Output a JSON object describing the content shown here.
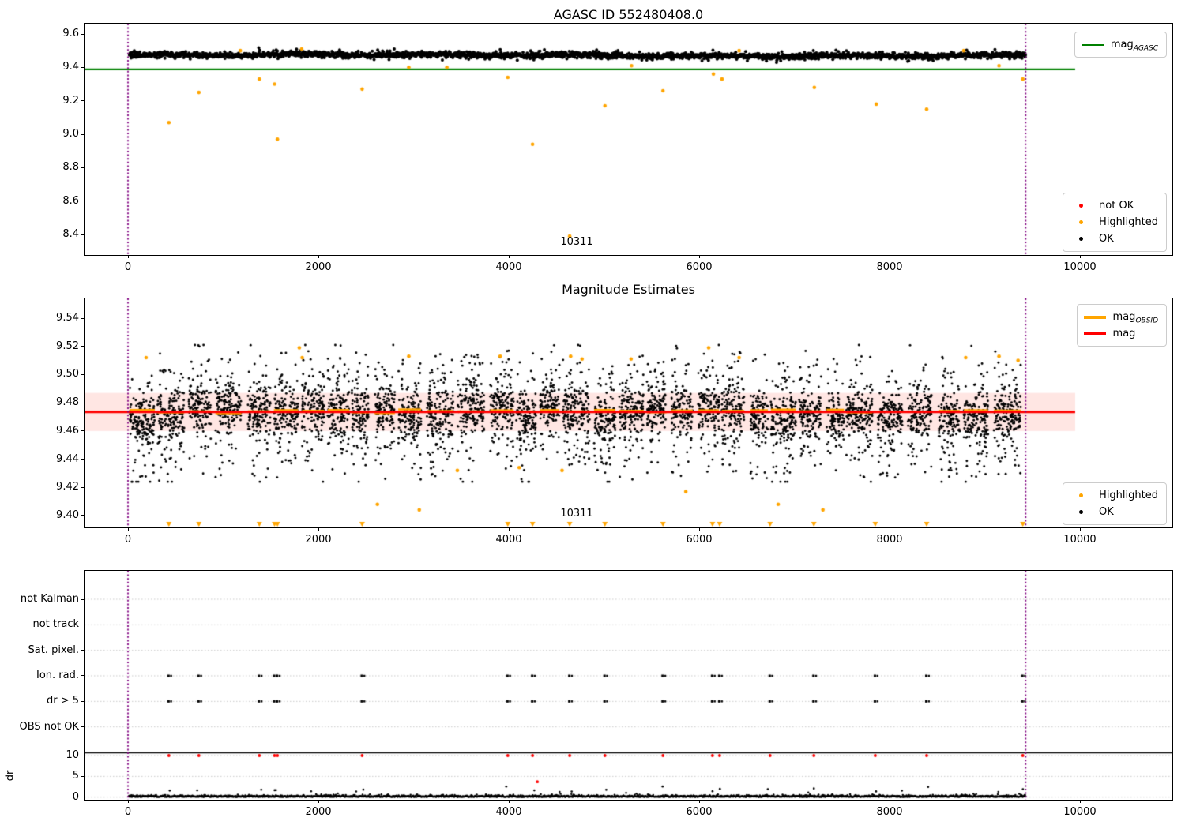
{
  "colors": {
    "ok": "#000000",
    "highlighted": "#ffa500",
    "not_ok": "#ff0000",
    "mag_agasc": "#008000",
    "mag": "#ff0000",
    "mag_obsid": "#ffa500",
    "obsid_boundary": "#800080",
    "band": "rgba(255,60,40,0.13)",
    "grid": "#c9c9c9"
  },
  "plots": {
    "top": {
      "title": "AGASC ID 552480408.0",
      "xtick_labels": [
        "0",
        "2000",
        "4000",
        "6000",
        "8000",
        "10000"
      ],
      "ytick_labels": [
        "9.6",
        "9.4",
        "9.2",
        "9.0",
        "8.8",
        "8.6",
        "8.4"
      ],
      "legend_agasc": {
        "pre": "mag",
        "sub": "AGASC"
      },
      "legend_items": [
        {
          "label": "not OK"
        },
        {
          "label": "Highlighted"
        },
        {
          "label": "OK"
        }
      ],
      "annotation": "10311"
    },
    "middle": {
      "title": "Magnitude Estimates",
      "xtick_labels": [
        "0",
        "2000",
        "4000",
        "6000",
        "8000",
        "10000"
      ],
      "ytick_labels": [
        "9.54",
        "9.52",
        "9.50",
        "9.48",
        "9.46",
        "9.44",
        "9.42",
        "9.40"
      ],
      "legend_lines": [
        {
          "pre": "mag",
          "sub": "OBSID"
        },
        {
          "pre": "mag",
          "sub": ""
        }
      ],
      "legend_items": [
        {
          "label": "Highlighted"
        },
        {
          "label": "OK"
        }
      ],
      "annotation": "10311"
    },
    "bottom": {
      "row_labels": [
        "not Kalman",
        "not track",
        "Sat. pixel.",
        "Ion. rad.",
        "dr > 5",
        "OBS not OK"
      ],
      "dr_tick_labels": [
        "10",
        "5",
        "0"
      ],
      "dr_label": "dr",
      "xtick_labels": [
        "0",
        "2000",
        "4000",
        "6000",
        "8000",
        "10000"
      ]
    }
  },
  "chart_data": [
    {
      "type": "scatter",
      "title": "AGASC ID 552480408.0",
      "xlim": [
        -456,
        10970
      ],
      "ylim": [
        8.277,
        9.661
      ],
      "xticks": [
        0,
        2000,
        4000,
        6000,
        8000,
        10000
      ],
      "yticks": [
        9.6,
        9.4,
        9.2,
        9.0,
        8.8,
        8.6,
        8.4
      ],
      "series": [
        {
          "name": "OK",
          "marker": "dot",
          "color": "#000000",
          "summary": {
            "x_range": [
              0,
              9430
            ],
            "mean_mag": 9.472,
            "scatter_sigma": 0.009,
            "band_range": [
              9.43,
              9.52
            ],
            "n_points_approx": 2700
          }
        },
        {
          "name": "Highlighted",
          "marker": "dot",
          "color": "#ffa500",
          "points": [
            [
              430,
              9.07
            ],
            [
              745,
              9.25
            ],
            [
              1180,
              9.5
            ],
            [
              1380,
              9.33
            ],
            [
              1540,
              9.3
            ],
            [
              1570,
              8.97
            ],
            [
              1825,
              9.51
            ],
            [
              2460,
              9.27
            ],
            [
              2950,
              9.4
            ],
            [
              3350,
              9.4
            ],
            [
              3990,
              9.34
            ],
            [
              4250,
              8.94
            ],
            [
              4640,
              8.39
            ],
            [
              5010,
              9.17
            ],
            [
              5290,
              9.41
            ],
            [
              5620,
              9.26
            ],
            [
              6150,
              9.36
            ],
            [
              6240,
              9.33
            ],
            [
              6420,
              9.5
            ],
            [
              7210,
              9.28
            ],
            [
              7860,
              9.18
            ],
            [
              8390,
              9.15
            ],
            [
              8780,
              9.5
            ],
            [
              9150,
              9.41
            ],
            [
              9400,
              9.33
            ]
          ]
        },
        {
          "name": "not OK",
          "marker": "dot",
          "color": "#ff0000",
          "points": []
        }
      ],
      "lines": [
        {
          "name": "mag_AGASC",
          "y": 9.388,
          "x_range": [
            -456,
            9950
          ],
          "color": "#008000"
        }
      ],
      "vlines": [
        0,
        9430
      ],
      "annotations": [
        {
          "text": "10311",
          "x": 4700,
          "y": 8.35
        }
      ],
      "legend_positions": [
        "upper right",
        "lower right"
      ]
    },
    {
      "type": "scatter",
      "title": "Magnitude Estimates",
      "xlim": [
        -456,
        10970
      ],
      "ylim": [
        9.3916,
        9.554
      ],
      "xticks": [
        0,
        2000,
        4000,
        6000,
        8000,
        10000
      ],
      "yticks": [
        9.54,
        9.52,
        9.5,
        9.48,
        9.46,
        9.44,
        9.42,
        9.4
      ],
      "series": [
        {
          "name": "OK",
          "marker": "dot",
          "color": "#000000",
          "summary": {
            "x_range": [
              0,
              9430
            ],
            "mean_mag": 9.4735,
            "core_range": [
              9.455,
              9.49
            ],
            "upper_tail": 9.515,
            "lower_tail": 9.425,
            "clustered_by_obsid": true,
            "cluster_spacing_approx": 270,
            "n_points_approx": 4600
          }
        },
        {
          "name": "Highlighted",
          "marker": "dot",
          "color": "#ffa500",
          "points": [
            [
              190,
              9.512
            ],
            [
              1800,
              9.519
            ],
            [
              1830,
              9.512
            ],
            [
              2620,
              9.408
            ],
            [
              2950,
              9.513
            ],
            [
              3060,
              9.404
            ],
            [
              3460,
              9.432
            ],
            [
              3910,
              9.513
            ],
            [
              4110,
              9.434
            ],
            [
              4560,
              9.432
            ],
            [
              4650,
              9.513
            ],
            [
              4770,
              9.511
            ],
            [
              5285,
              9.511
            ],
            [
              5860,
              9.417
            ],
            [
              6100,
              9.519
            ],
            [
              6420,
              9.512
            ],
            [
              6830,
              9.408
            ],
            [
              7300,
              9.404
            ],
            [
              8800,
              9.512
            ],
            [
              9150,
              9.513
            ],
            [
              9350,
              9.51
            ]
          ]
        },
        {
          "name": "Highlighted (clipped below axis)",
          "marker": "triangle-down",
          "color": "#ffa500",
          "x": [
            430,
            745,
            1380,
            1540,
            1570,
            2460,
            3990,
            4250,
            4640,
            5010,
            5620,
            6140,
            6215,
            6745,
            7205,
            7850,
            8390,
            9400
          ],
          "y_drawn_at": 9.3938
        }
      ],
      "lines": [
        {
          "name": "mag",
          "y": 9.4735,
          "x_range": [
            -456,
            9950
          ],
          "color": "#ff0000"
        },
        {
          "name": "mag_OBSID",
          "y_approx": 9.474,
          "per_obsid_segments": true,
          "color": "#ffa500"
        }
      ],
      "band": {
        "y": [
          9.46,
          9.487
        ],
        "x_range": [
          -456,
          9950
        ],
        "color": "rgba(255,0,0,0.12)"
      },
      "vlines": [
        0,
        9430
      ],
      "annotations": [
        {
          "text": "10311",
          "x": 4700,
          "y": 9.4
        }
      ]
    },
    {
      "type": "flags-and-dr",
      "flag_rows": [
        "not Kalman",
        "not track",
        "Sat. pixel.",
        "Ion. rad.",
        "dr > 5",
        "OBS not OK"
      ],
      "rows_with_points": [
        "Ion. rad.",
        "dr > 5"
      ],
      "flagged_x": [
        430,
        745,
        1380,
        1540,
        1570,
        2460,
        3990,
        4250,
        4640,
        5010,
        5620,
        6140,
        6215,
        6745,
        7205,
        7850,
        8390,
        9400
      ],
      "dr_axis": {
        "label": "dr",
        "ticks": [
          10,
          5,
          0
        ],
        "ok_summary": {
          "x_range": [
            0,
            9430
          ],
          "typical_dr": 0.3,
          "occasional_dr_max": 2.6
        },
        "not_ok_points_at_10": [
          430,
          745,
          1380,
          1540,
          1570,
          2460,
          3990,
          4250,
          4640,
          5010,
          5620,
          6140,
          6215,
          6745,
          7205,
          7850,
          8390,
          9400
        ],
        "not_ok_other": [
          [
            4300,
            3.7
          ]
        ],
        "separator_line_above_10": true
      },
      "xticks": [
        0,
        2000,
        4000,
        6000,
        8000,
        10000
      ],
      "vlines": [
        0,
        9430
      ],
      "grid": "dotted"
    }
  ]
}
